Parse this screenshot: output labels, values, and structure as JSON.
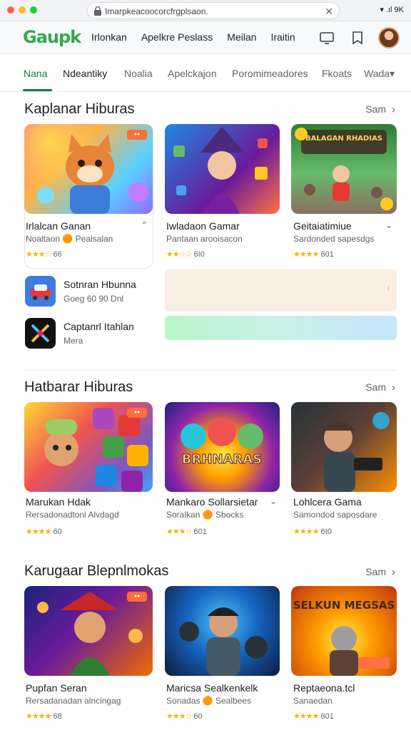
{
  "browser": {
    "url": "Imarpkeacoocorcfrgplsaon.",
    "status": "▾ .ıl 9K"
  },
  "app": {
    "logo": "Gaupk",
    "nav": [
      "Irlonkan",
      "Apelkre Peslass",
      "Meilan",
      "Iraitin"
    ]
  },
  "tabs": [
    "Nana",
    "Ndeantiky",
    "Noalia",
    "Apelckajon",
    "Poromimeadores",
    "Fkoats",
    "Wada▾"
  ],
  "sections": [
    {
      "title": "Kaplanar Hiburas",
      "see_all": "Sam",
      "cards": [
        {
          "title": "Irlalcan Ganan",
          "subtitle": "Noaltaon 🟠 Pealsalan",
          "stars": "★★★☆",
          "rating": "66"
        },
        {
          "title": "Iwladaon Gamar",
          "subtitle": "Pantaan arooisacon",
          "stars": "★★☆☆",
          "rating": "6I0"
        },
        {
          "title": "Geitaiatimiue",
          "subtitle": "Sardonded sapesdgs",
          "stars": "★★★★",
          "rating": "601"
        }
      ],
      "list": [
        {
          "title": "Sotnran Hbunna",
          "subtitle": "Goeg 60 90 Dnl"
        },
        {
          "title": "Captanrl Itahlan",
          "subtitle": "Mera"
        }
      ]
    },
    {
      "title": "Hatbarar Hiburas",
      "see_all": "Sam",
      "cards": [
        {
          "title": "Marukan Hdak",
          "subtitle": "Rersadonadtonl Alvdagd",
          "stars": "★★★★",
          "rating": "60"
        },
        {
          "title": "Mankaro Sollarsietar",
          "subtitle": "Soralkan 🟠 Sbocks",
          "stars": "★★★☆",
          "rating": "601"
        },
        {
          "title": "Lohlcera Gama",
          "subtitle": "Samondod saposdare",
          "stars": "★★★★",
          "rating": "6I0"
        }
      ]
    },
    {
      "title": "Karugaar Blepnlmokas",
      "see_all": "Sam",
      "cards": [
        {
          "title": "Pupfan Seran",
          "subtitle": "Rersadanadan alncingag",
          "stars": "★★★★",
          "rating": "68"
        },
        {
          "title": "Maricsa Sealkenkelk",
          "subtitle": "Sonadas 🟠 Sealbees",
          "stars": "★★★☆",
          "rating": "60"
        },
        {
          "title": "Reptaeona.tcl",
          "subtitle": "Sanaedan",
          "stars": "★★★★",
          "rating": "601"
        }
      ]
    }
  ],
  "art_text": {
    "game3": "BALAGAN RHADIAS",
    "game5": "BRHNARAS",
    "game9": "SELKUN MEGSAS"
  },
  "colors": {
    "accent": "#0b8043",
    "logo": "#34a853",
    "star": "#f5b400"
  }
}
